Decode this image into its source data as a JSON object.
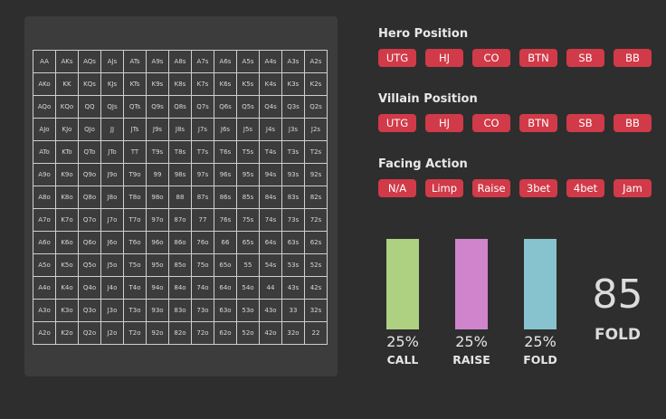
{
  "hand_matrix": [
    [
      "AA",
      "AKs",
      "AQs",
      "AJs",
      "ATs",
      "A9s",
      "A8s",
      "A7s",
      "A6s",
      "A5s",
      "A4s",
      "A3s",
      "A2s"
    ],
    [
      "AKo",
      "KK",
      "KQs",
      "KJs",
      "KTs",
      "K9s",
      "K8s",
      "K7s",
      "K6s",
      "K5s",
      "K4s",
      "K3s",
      "K2s"
    ],
    [
      "AQo",
      "KQo",
      "QQ",
      "QJs",
      "QTs",
      "Q9s",
      "Q8s",
      "Q7s",
      "Q6s",
      "Q5s",
      "Q4s",
      "Q3s",
      "Q2s"
    ],
    [
      "AJo",
      "KJo",
      "QJo",
      "JJ",
      "JTs",
      "J9s",
      "J8s",
      "J7s",
      "J6s",
      "J5s",
      "J4s",
      "J3s",
      "J2s"
    ],
    [
      "ATo",
      "KTo",
      "QTo",
      "JTo",
      "TT",
      "T9s",
      "T8s",
      "T7s",
      "T6s",
      "T5s",
      "T4s",
      "T3s",
      "T2s"
    ],
    [
      "A9o",
      "K9o",
      "Q9o",
      "J9o",
      "T9o",
      "99",
      "98s",
      "97s",
      "96s",
      "95s",
      "94s",
      "93s",
      "92s"
    ],
    [
      "A8o",
      "K8o",
      "Q8o",
      "J8o",
      "T8o",
      "98o",
      "88",
      "87s",
      "86s",
      "85s",
      "84s",
      "83s",
      "82s"
    ],
    [
      "A7o",
      "K7o",
      "Q7o",
      "J7o",
      "T7o",
      "97o",
      "87o",
      "77",
      "76s",
      "75s",
      "74s",
      "73s",
      "72s"
    ],
    [
      "A6o",
      "K6o",
      "Q6o",
      "J6o",
      "T6o",
      "96o",
      "86o",
      "76o",
      "66",
      "65s",
      "64s",
      "63s",
      "62s"
    ],
    [
      "A5o",
      "K5o",
      "Q5o",
      "J5o",
      "T5o",
      "95o",
      "85o",
      "75o",
      "65o",
      "55",
      "54s",
      "53s",
      "52s"
    ],
    [
      "A4o",
      "K4o",
      "Q4o",
      "J4o",
      "T4o",
      "94o",
      "84o",
      "74o",
      "64o",
      "54o",
      "44",
      "43s",
      "42s"
    ],
    [
      "A3o",
      "K3o",
      "Q3o",
      "J3o",
      "T3o",
      "93o",
      "83o",
      "73o",
      "63o",
      "53o",
      "43o",
      "33",
      "32s"
    ],
    [
      "A2o",
      "K2o",
      "Q2o",
      "J2o",
      "T2o",
      "92o",
      "82o",
      "72o",
      "62o",
      "52o",
      "42o",
      "32o",
      "22"
    ]
  ],
  "hero_position": {
    "title": "Hero Position",
    "options": [
      "UTG",
      "HJ",
      "CO",
      "BTN",
      "SB",
      "BB"
    ]
  },
  "villain_position": {
    "title": "Villain Position",
    "options": [
      "UTG",
      "HJ",
      "CO",
      "BTN",
      "SB",
      "BB"
    ]
  },
  "facing_action": {
    "title": "Facing Action",
    "options": [
      "N/A",
      "Limp",
      "Raise",
      "3bet",
      "4bet",
      "Jam"
    ]
  },
  "frequencies": [
    {
      "label": "CALL",
      "percent_text": "25%",
      "color": "#aed081"
    },
    {
      "label": "RAISE",
      "percent_text": "25%",
      "color": "#d084cc"
    },
    {
      "label": "FOLD",
      "percent_text": "25%",
      "color": "#86c3cf"
    }
  ],
  "result": {
    "value": "85",
    "label": "FOLD"
  },
  "colors": {
    "background": "#2e2e2e",
    "panel": "#3c3c3c",
    "button": "#d13a48"
  }
}
